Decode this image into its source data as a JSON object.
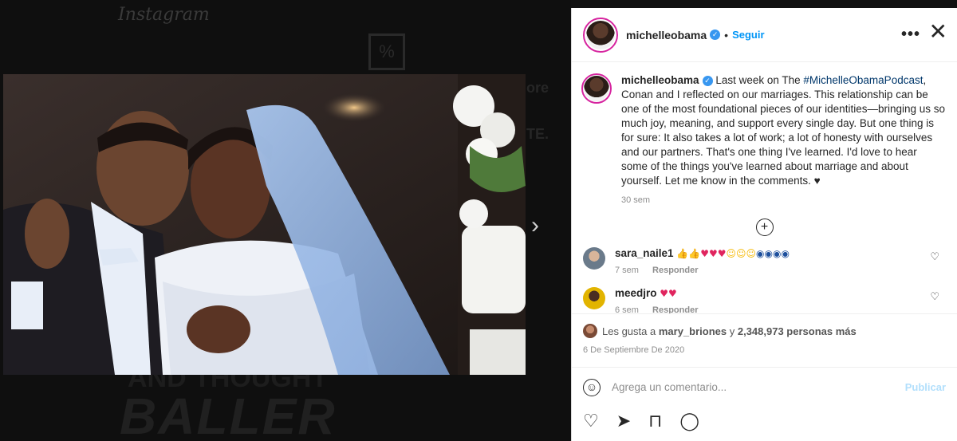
{
  "background": {
    "logo": "Instagram",
    "headline_bottom": "BALLER",
    "headline_mid": "AND THOUGHT",
    "box_glyph": "%",
    "side_text_1": "ore",
    "side_text_2": "TE."
  },
  "viewer": {
    "next_arrow": "›"
  },
  "header": {
    "username": "michelleobama",
    "separator": "•",
    "follow_label": "Seguir",
    "more_label": "•••",
    "close_label": "✕"
  },
  "caption": {
    "username": "michelleobama",
    "text_before_tag": "Last week on The ",
    "hashtag": "#MichelleObamaPodcast",
    "text_after_tag": ", Conan and I reflected on our marriages. This relationship can be one of the most foundational pieces of our identities—bringing us so much joy, meaning, and support every single day. But one thing is for sure: It also takes a lot of work; a lot of honesty with ourselves and our partners. That's one thing I've learned. I'd love to hear some of the things you've learned about marriage and about yourself. Let me know in the comments. ",
    "heart": "♥",
    "time": "30 sem",
    "load_more": "+"
  },
  "comments": [
    {
      "username": "sara_naile1",
      "time": "7 sem",
      "reply": "Responder"
    },
    {
      "username": "meedjro",
      "time": "6 sem",
      "reply": "Responder"
    }
  ],
  "likes": {
    "prefix": "Les gusta a",
    "user": "mary_briones",
    "conj": "y",
    "count": "2,348,973 personas más"
  },
  "date": "6 De Septiembre De 2020",
  "comment_box": {
    "placeholder": "Agrega un comentario...",
    "publish_label": "Publicar"
  },
  "colors": {
    "accent": "#0095f6",
    "verified": "#3897f0",
    "publish_disabled": "#b2dffc",
    "story_ring": "#d6249f"
  }
}
